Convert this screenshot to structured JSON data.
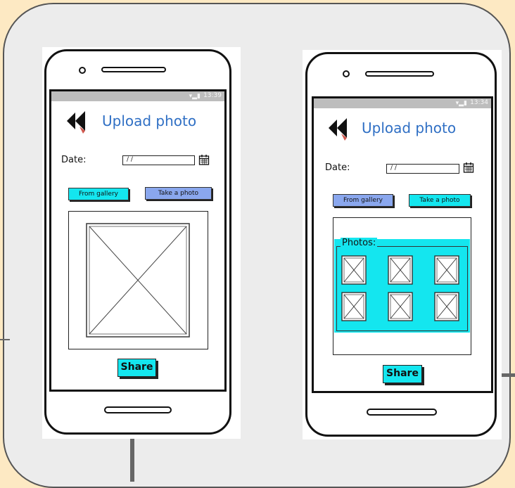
{
  "colors": {
    "accent_cyan": "#14e6ef",
    "button_blue": "#8aa7ee",
    "title_blue": "#2f6fc4",
    "background": "#fde9c3",
    "board": "#ececec"
  },
  "left_screen": {
    "status": {
      "time": "13:39",
      "icons": "wifi-signal-battery"
    },
    "title": "Upload photo",
    "date_label": "Date:",
    "date_value": "/ /",
    "gallery_button": "From gallery",
    "camera_button": "Take a photo",
    "share_button": "Share"
  },
  "right_screen": {
    "status": {
      "time": "13:34",
      "icons": "wifi-signal-battery"
    },
    "title": "Upload photo",
    "date_label": "Date:",
    "date_value": "/ /",
    "gallery_button": "From gallery",
    "camera_button": "Take a photo",
    "photos_label": "Photos:",
    "thumbnail_count": 6,
    "share_button": "Share"
  }
}
